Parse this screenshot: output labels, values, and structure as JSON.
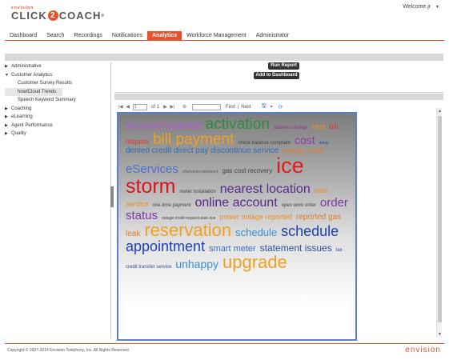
{
  "header": {
    "brand_top": "envision",
    "brand_click": "CLICK",
    "brand_2": "2",
    "brand_coach": "COACH",
    "brand_reg": "®",
    "welcome": "Welcome jr",
    "welcome_caret": "▼"
  },
  "nav": {
    "items": [
      "Dashboard",
      "Search",
      "Recordings",
      "Notifications",
      "Analytics",
      "Workforce Management",
      "Administrator"
    ],
    "active_index": 4
  },
  "sidebar": {
    "items": [
      {
        "label": "Administrative",
        "arrow": "▶"
      },
      {
        "label": "Customer Analytics",
        "arrow": "▼"
      },
      {
        "label": "Customer Survey Results"
      },
      {
        "label": "howICloud Trends"
      },
      {
        "label": "Speech Keyword Summary"
      },
      {
        "label": "Coaching",
        "arrow": "▶"
      },
      {
        "label": "eLearning",
        "arrow": "▶"
      },
      {
        "label": "Agent Performance",
        "arrow": "▶"
      },
      {
        "label": "Quality",
        "arrow": "▶"
      }
    ]
  },
  "controls": {
    "run_report": "Run Report",
    "add_to_dashboard": "Add to Dashboard"
  },
  "toolbar": {
    "first_icon": "|◀",
    "prev_icon": "◀",
    "page_value": "1",
    "of_text": "of 1",
    "next_icon": "▶",
    "last_icon": "▶|",
    "zoom_icon": "⊕",
    "find": "Find",
    "separator": "|",
    "next": "Next",
    "save_icon": "🖫",
    "save_caret": "▾",
    "refresh_icon": "⟳"
  },
  "word_cloud": [
    {
      "t": "account balance",
      "s": 13,
      "c": "#b85cd6"
    },
    {
      "t": "activation",
      "s": 19,
      "c": "#2e8b3e"
    },
    {
      "t": "address change",
      "s": 6,
      "c": "#8a3a8a"
    },
    {
      "t": "best",
      "s": 9,
      "c": "#f28c28"
    },
    {
      "t": "bill dispute",
      "s": 9,
      "c": "#e03a2a"
    },
    {
      "t": "bill payment",
      "s": 19,
      "c": "#f0a020"
    },
    {
      "t": "check balance complaint",
      "s": 6,
      "c": "#444444"
    },
    {
      "t": "cost",
      "s": 14,
      "c": "#8e3aa5"
    },
    {
      "t": "delay",
      "s": 5,
      "c": "#2a4f9a"
    },
    {
      "t": "denied credit direct pay discontinue service",
      "s": 10,
      "c": "#2f6db5"
    },
    {
      "t": "energy credit",
      "s": 9,
      "c": "#e07a30"
    },
    {
      "t": "eServices",
      "s": 15,
      "c": "#4a6fd0"
    },
    {
      "t": "eServices password",
      "s": 5,
      "c": "#555555"
    },
    {
      "t": "gas cost recovery",
      "s": 8,
      "c": "#444444"
    },
    {
      "t": "ice",
      "s": 27,
      "c": "#e01a1a"
    },
    {
      "t": "storm",
      "s": 25,
      "c": "#d8161a"
    },
    {
      "t": "meter installation",
      "s": 6,
      "c": "#444444"
    },
    {
      "t": "nearest location",
      "s": 16,
      "c": "#5a2a8a"
    },
    {
      "t": "new",
      "s": 9,
      "c": "#f28c28"
    },
    {
      "t": "service",
      "s": 9,
      "c": "#f28c28"
    },
    {
      "t": "one-time payment",
      "s": 6,
      "c": "#444444"
    },
    {
      "t": "online account",
      "s": 16,
      "c": "#5a2a8a"
    },
    {
      "t": "open work order",
      "s": 6,
      "c": "#444444"
    },
    {
      "t": "order status",
      "s": 15,
      "c": "#7a3aa5"
    },
    {
      "t": "outage credit request past due",
      "s": 5,
      "c": "#444444"
    },
    {
      "t": "power outage reported",
      "s": 9,
      "c": "#f28c28"
    },
    {
      "t": "reported gas leak",
      "s": 10,
      "c": "#e07a30"
    },
    {
      "t": "reservation",
      "s": 22,
      "c": "#f0a020"
    },
    {
      "t": "schedule",
      "s": 13,
      "c": "#3a8fd6"
    },
    {
      "t": "schedule appointment",
      "s": 18,
      "c": "#1d3fb0"
    },
    {
      "t": "smart meter",
      "s": 11,
      "c": "#3a6fc0"
    },
    {
      "t": "statement issues",
      "s": 12,
      "c": "#2a4f9a"
    },
    {
      "t": "tax credit transfer service",
      "s": 6,
      "c": "#2a4f9a"
    },
    {
      "t": "unhappy",
      "s": 14,
      "c": "#3a8fd6"
    },
    {
      "t": "upgrade",
      "s": 22,
      "c": "#f0a020"
    }
  ],
  "scroll": {
    "up": "▲",
    "down": "▼"
  },
  "footer": {
    "copyright": "Copyright © 2007-2014 Envision Telephony, Inc. All Rights Reserved.",
    "logo": "envision"
  },
  "colors": {
    "brand": "#e2522b",
    "cloud_border": "#5b7fc7"
  }
}
